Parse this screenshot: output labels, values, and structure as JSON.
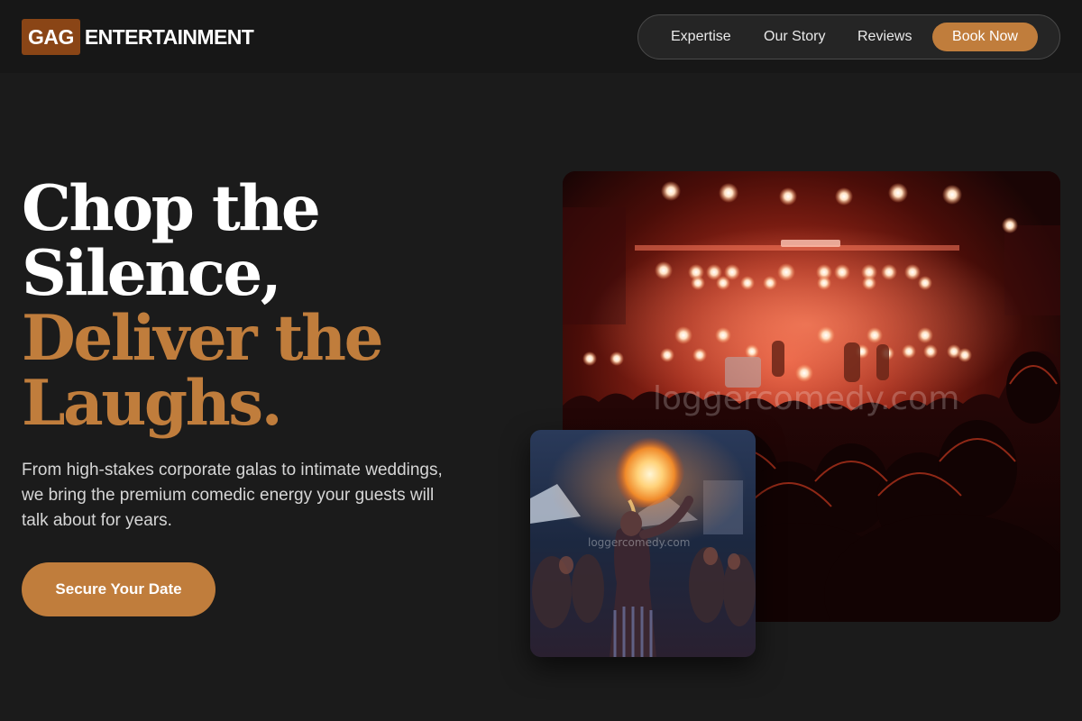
{
  "brand": {
    "mark": "GAG",
    "name": "ENTERTAINMENT"
  },
  "nav": {
    "links": [
      "Expertise",
      "Our Story",
      "Reviews"
    ],
    "book_label": "Book Now"
  },
  "hero": {
    "headline_white": [
      "Chop the",
      "Silence,"
    ],
    "headline_accent": [
      "Deliver the",
      "Laughs."
    ],
    "subtext": "From high-stakes corporate galas to intimate weddings, we bring the premium comedic energy your guests will talk about for years.",
    "cta_label": "Secure Your Date"
  },
  "images": {
    "concert_watermark": "loggercomedy.com",
    "fire_watermark": "loggercomedy.com"
  },
  "colors": {
    "background": "#1b1b1b",
    "header": "#171717",
    "accent": "#c07d3c",
    "logo_mark": "#8a4516"
  }
}
